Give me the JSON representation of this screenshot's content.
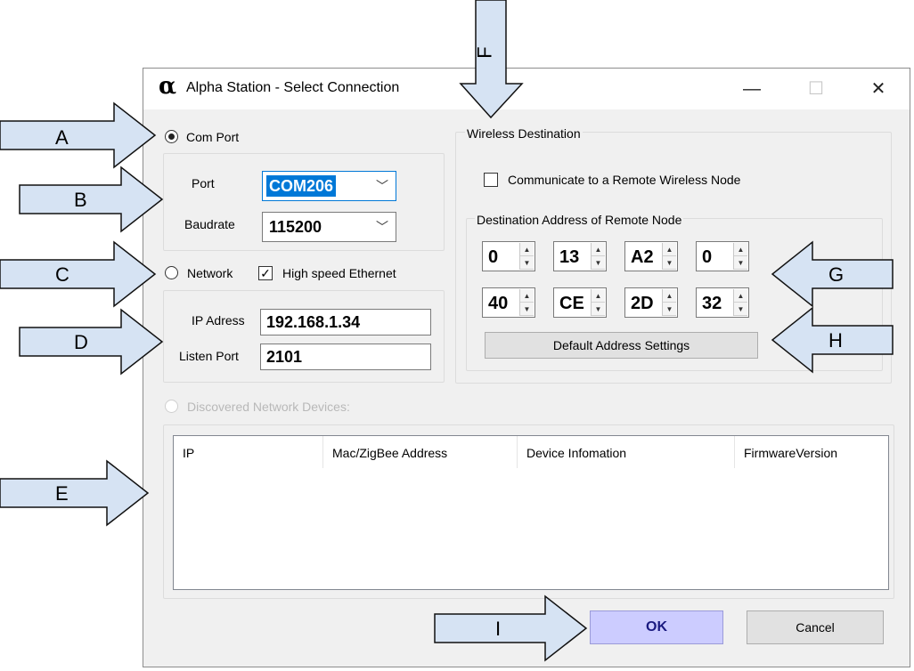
{
  "window": {
    "title": "Alpha Station - Select Connection",
    "icon": "alpha-icon",
    "icon_glyph": "α",
    "controls": {
      "minimize": "—",
      "maximize": "☐",
      "close": "✕"
    }
  },
  "com_port": {
    "label": "Com Port",
    "selected": true,
    "port_label": "Port",
    "port_value": "COM206",
    "baud_label": "Baudrate",
    "baud_value": "115200"
  },
  "network": {
    "label": "Network",
    "selected": false,
    "high_speed_label": "High speed Ethernet",
    "high_speed_checked": true,
    "ip_label": "IP Adress",
    "ip_value": "192.168.1.34",
    "listen_label": "Listen Port",
    "listen_value": "2101"
  },
  "wireless": {
    "group_label": "Wireless Destination",
    "remote_label": "Communicate to a Remote Wireless Node",
    "remote_checked": false,
    "dest_group_label": "Destination Address of Remote Node",
    "address_bytes": [
      "0",
      "13",
      "A2",
      "0",
      "40",
      "CE",
      "2D",
      "32"
    ],
    "default_button": "Default Address Settings"
  },
  "discovered": {
    "label": "Discovered Network Devices:",
    "enabled": false,
    "columns": [
      "IP",
      "Mac/ZigBee Address",
      "Device Infomation",
      "FirmwareVersion"
    ]
  },
  "buttons": {
    "ok": "OK",
    "cancel": "Cancel"
  },
  "callouts": [
    "A",
    "B",
    "C",
    "D",
    "E",
    "F",
    "G",
    "H",
    "I"
  ],
  "colors": {
    "callout_fill": "#d6e3f3",
    "ok_button": "#ccccff",
    "selection": "#0078d7"
  }
}
